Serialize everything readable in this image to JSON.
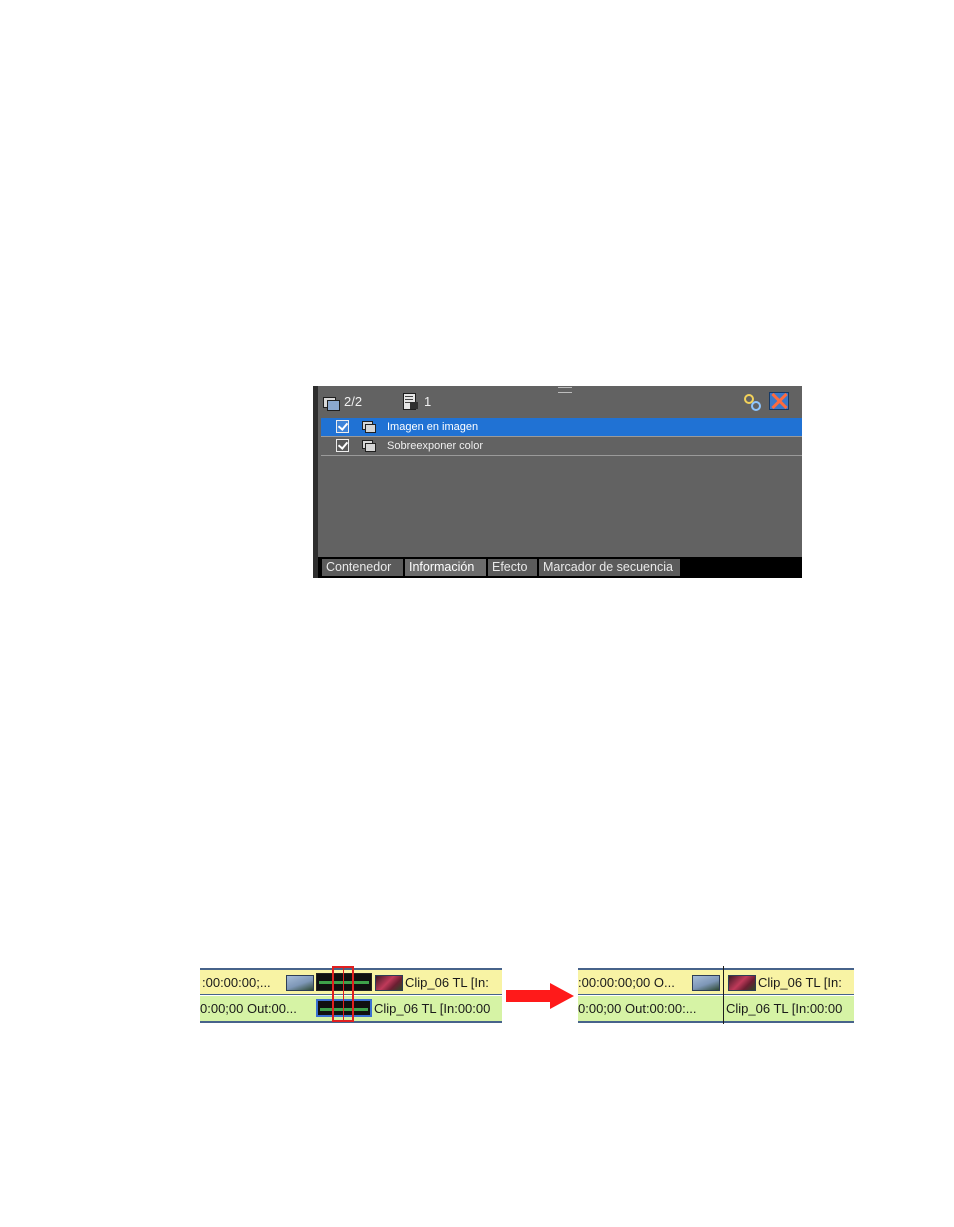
{
  "info_panel": {
    "toolbar": {
      "layer_count": "2/2",
      "doc_count": "1"
    },
    "effects": [
      {
        "label": "Imagen en imagen",
        "checked": true,
        "selected": true
      },
      {
        "label": "Sobreexponer color",
        "checked": true,
        "selected": false
      }
    ],
    "tabs": [
      {
        "label": "Contenedor",
        "active": false
      },
      {
        "label": "Información",
        "active": true
      },
      {
        "label": "Efecto",
        "active": false
      },
      {
        "label": "Marcador de secuencia",
        "active": false
      }
    ]
  },
  "timeline_before": {
    "top_left_text": ":00:00:00;...",
    "top_clip_text": "Clip_06  TL [In:",
    "bottom_left_text": "0:00;00 Out:00...",
    "bottom_clip_text": "Clip_06  TL [In:00:00"
  },
  "timeline_after": {
    "top_left_text": ":00:00:00;00 O...",
    "top_clip_text": "Clip_06  TL [In:",
    "bottom_left_text": "0:00;00 Out:00:00:...",
    "bottom_clip_text": "Clip_06  TL [In:00:00"
  },
  "colors": {
    "panel_bg": "#626262",
    "selection": "#2072d4",
    "video_track": "#f8f3a4",
    "audio_track": "#d6f3a5",
    "highlight": "#e02020",
    "arrow": "#ff1a1a"
  }
}
